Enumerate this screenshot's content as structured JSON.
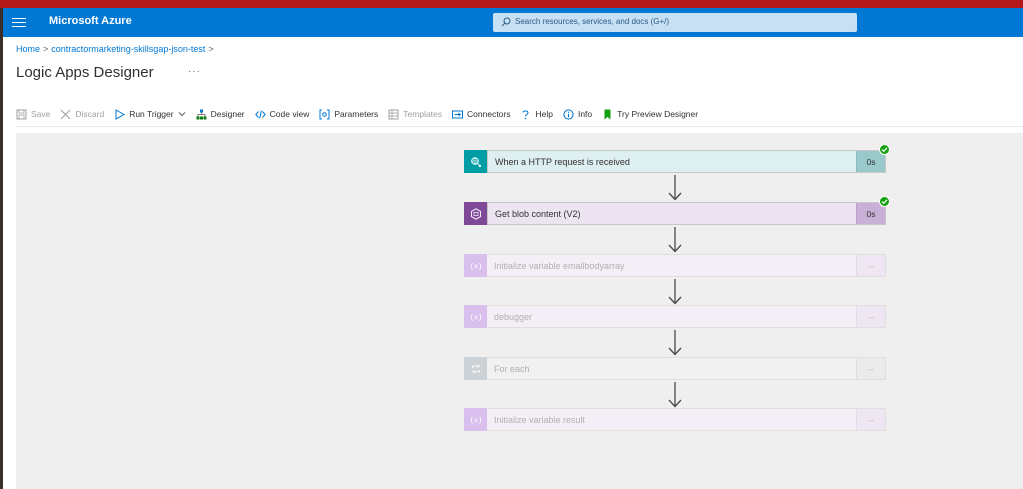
{
  "header": {
    "brand": "Microsoft Azure",
    "search_placeholder": "Search resources, services, and docs (G+/)"
  },
  "breadcrumb": {
    "home": "Home",
    "resource": "contractormarketing-skillsgap-json-test"
  },
  "page": {
    "title": "Logic Apps Designer",
    "more": "···"
  },
  "toolbar": {
    "save": "Save",
    "discard": "Discard",
    "run_trigger": "Run Trigger",
    "designer": "Designer",
    "code_view": "Code view",
    "parameters": "Parameters",
    "templates": "Templates",
    "connectors": "Connectors",
    "help": "Help",
    "info": "Info",
    "try_preview": "Try Preview Designer"
  },
  "steps": [
    {
      "label": "When a HTTP request is received",
      "duration": "0s",
      "status": "succeeded",
      "icon": "http-request-icon",
      "color": "#009da5"
    },
    {
      "label": "Get blob content (V2)",
      "duration": "0s",
      "status": "succeeded",
      "icon": "blob-storage-icon",
      "color": "#804998"
    },
    {
      "label": "Initialize variable emailbodyarray",
      "duration": "--",
      "status": "not-run",
      "icon": "variable-icon",
      "color": "#cba6e7"
    },
    {
      "label": "debugger",
      "duration": "--",
      "status": "not-run",
      "icon": "variable-icon",
      "color": "#cba6e7"
    },
    {
      "label": "For each",
      "duration": "--",
      "status": "not-run",
      "icon": "loop-icon",
      "color": "#c4c8cc"
    },
    {
      "label": "Initialize variable result",
      "duration": "--",
      "status": "not-run",
      "icon": "variable-icon",
      "color": "#cba6e7"
    }
  ]
}
